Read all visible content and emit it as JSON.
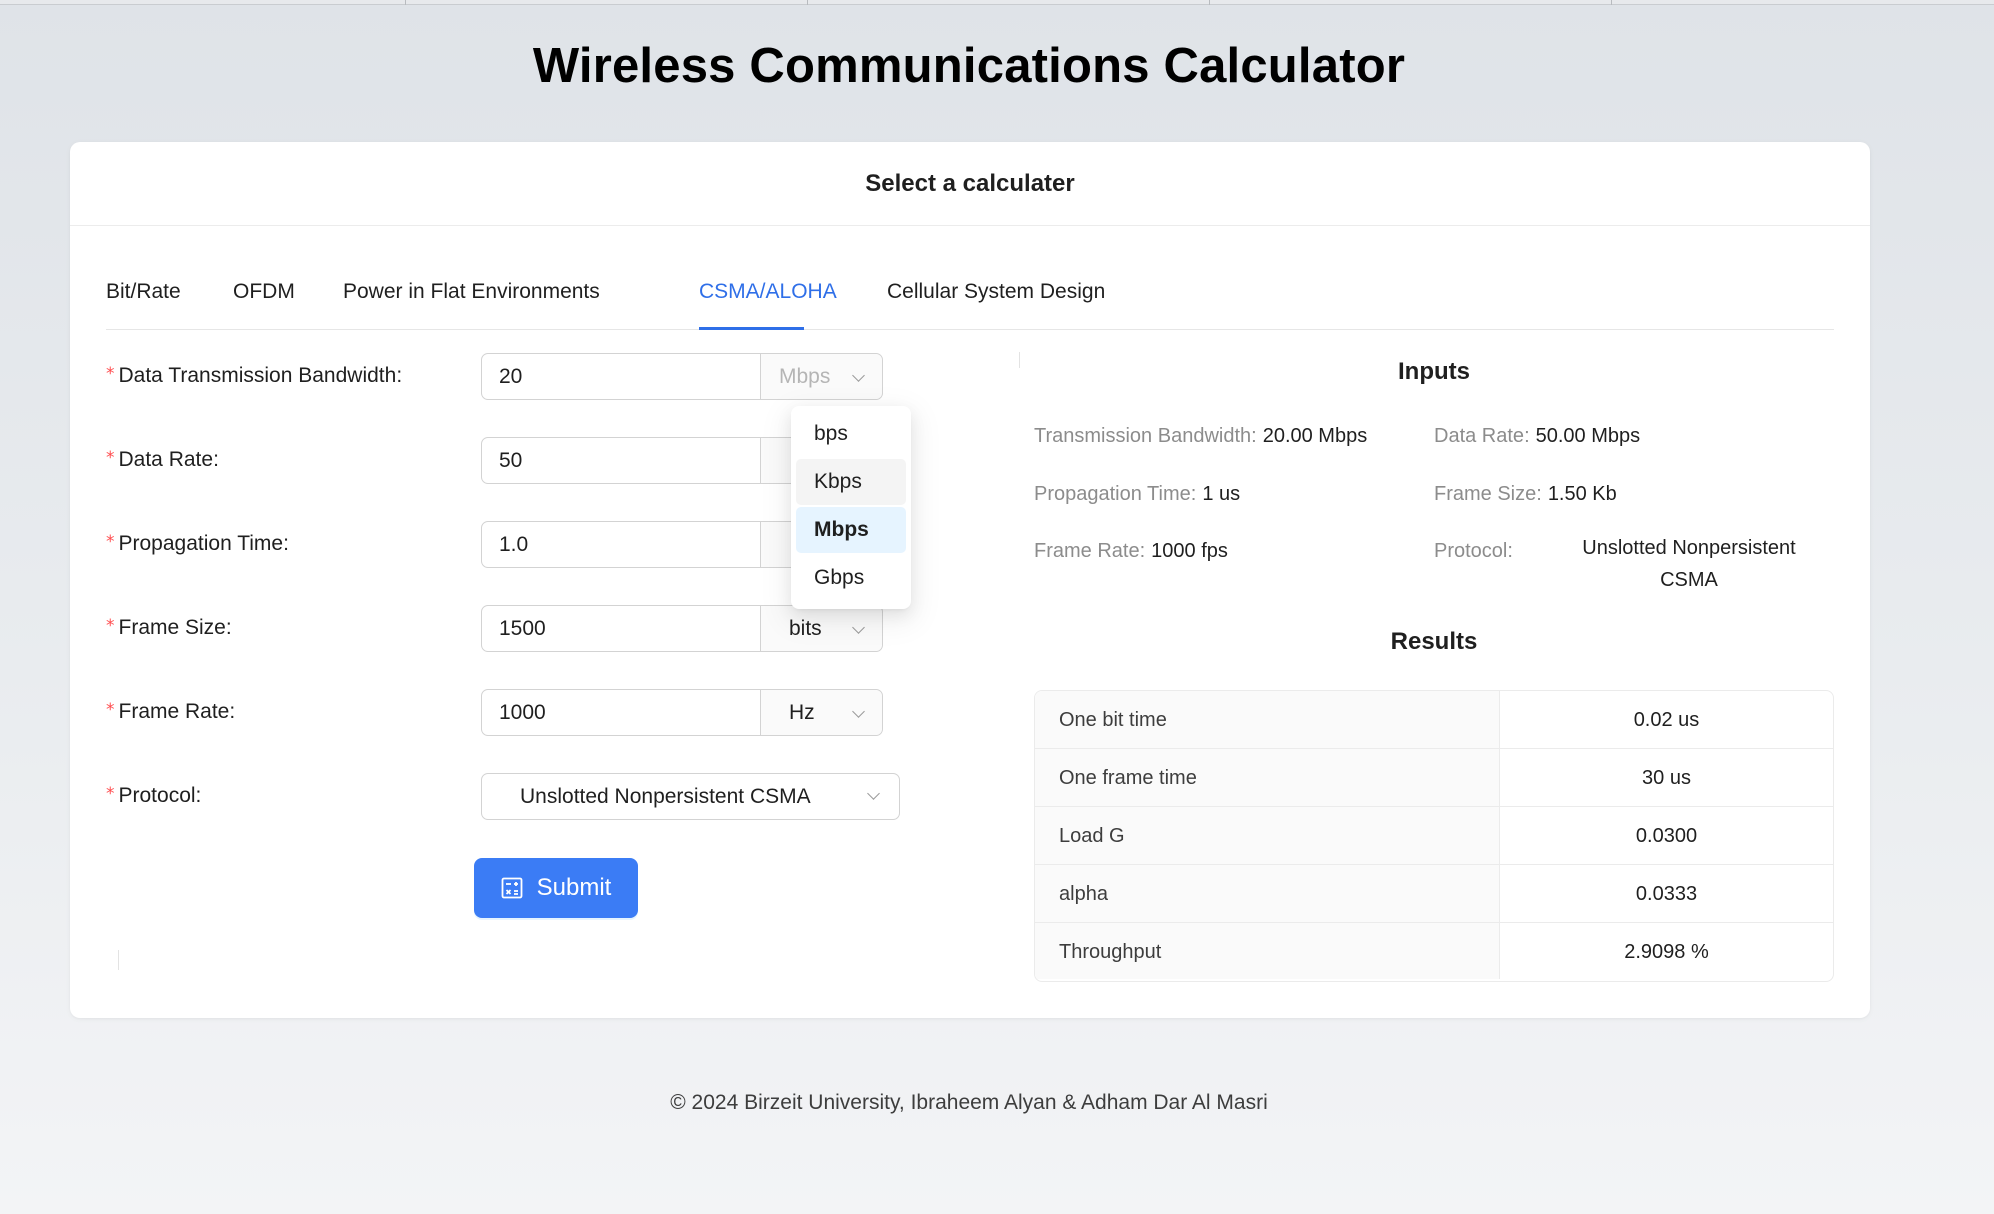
{
  "app_title": "Wireless Communications Calculator",
  "card_title": "Select a calculater",
  "tabs": [
    {
      "label": "Bit/Rate"
    },
    {
      "label": "OFDM"
    },
    {
      "label": "Power in Flat Environments"
    },
    {
      "label": "CSMA/ALOHA",
      "active": true
    },
    {
      "label": "Cellular System Design"
    }
  ],
  "form": {
    "bandwidth": {
      "label": "Data Transmission Bandwidth",
      "value": "20",
      "unit": "Mbps"
    },
    "data_rate": {
      "label": "Data Rate",
      "value": "50"
    },
    "prop_time": {
      "label": "Propagation Time",
      "value": "1.0"
    },
    "frame_size": {
      "label": "Frame Size",
      "value": "1500",
      "unit": "bits"
    },
    "frame_rate": {
      "label": "Frame Rate",
      "value": "1000",
      "unit": "Hz"
    },
    "protocol": {
      "label": "Protocol",
      "value": "Unslotted Nonpersistent CSMA"
    },
    "submit_label": "Submit"
  },
  "label_colon": ":",
  "required_mark": "*",
  "unit_dropdown": {
    "options": [
      "bps",
      "Kbps",
      "Mbps",
      "Gbps"
    ],
    "hovered": "Kbps",
    "selected": "Mbps"
  },
  "inputs_panel": {
    "title": "Inputs",
    "transmission_bandwidth": {
      "label": "Transmission Bandwidth",
      "value": "20.00 Mbps"
    },
    "data_rate": {
      "label": "Data Rate",
      "value": "50.00 Mbps"
    },
    "propagation_time": {
      "label": "Propagation Time",
      "value": "1 us"
    },
    "frame_size": {
      "label": "Frame Size",
      "value": "1.50 Kb"
    },
    "frame_rate": {
      "label": "Frame Rate",
      "value": "1000 fps"
    },
    "protocol": {
      "label": "Protocol",
      "value": "Unslotted Nonpersistent CSMA"
    }
  },
  "results": {
    "title": "Results",
    "rows": [
      {
        "label": "One bit time",
        "value": "0.02 us"
      },
      {
        "label": "One frame time",
        "value": "30 us"
      },
      {
        "label": "Load G",
        "value": "0.0300"
      },
      {
        "label": "alpha",
        "value": "0.0333"
      },
      {
        "label": "Throughput",
        "value": "2.9098 %"
      }
    ]
  },
  "footer": "© 2024 Birzeit University, Ibraheem Alyan & Adham Dar Al Masri",
  "colors": {
    "accent": "#3b7cf5",
    "required": "#ff4d4f",
    "selected_bg": "#e6f4ff"
  }
}
